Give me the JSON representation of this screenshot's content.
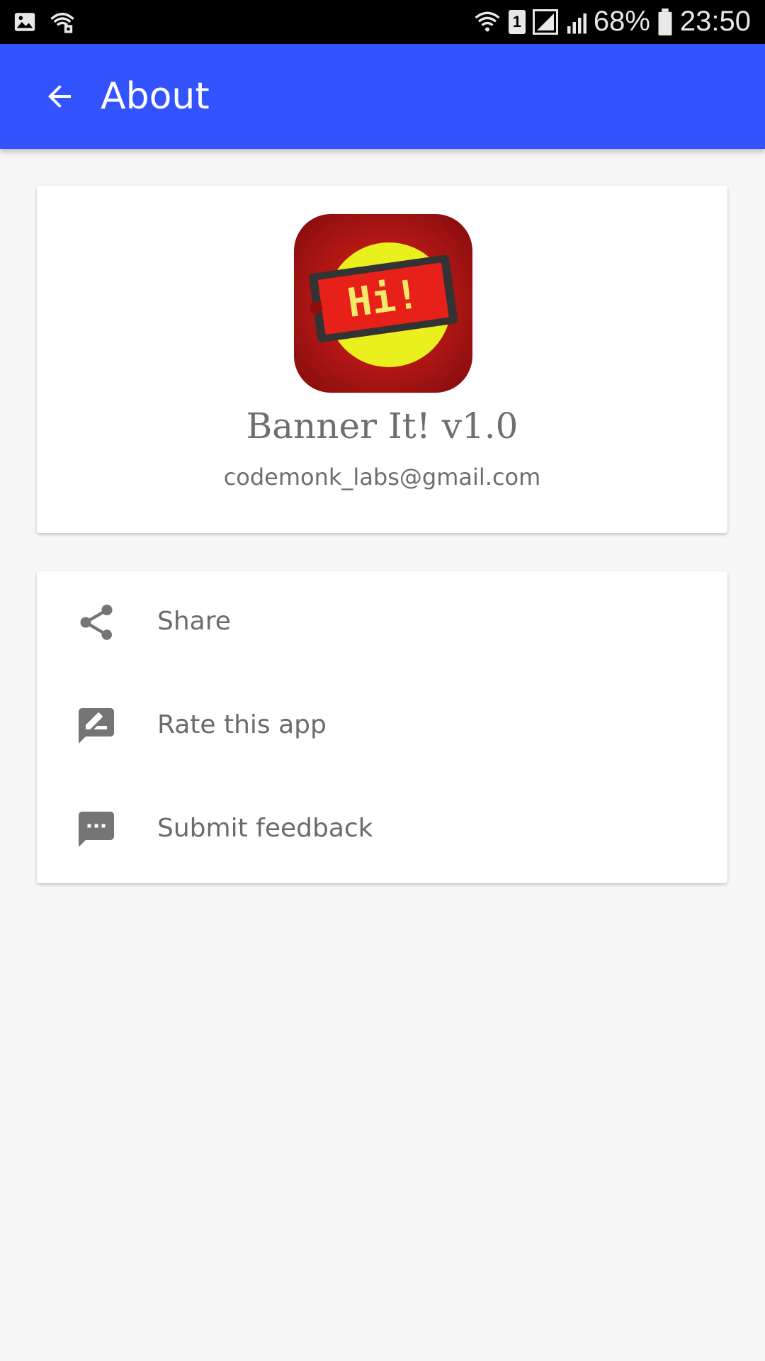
{
  "status_bar": {
    "sim_slot": "1",
    "battery": "68%",
    "time": "23:50"
  },
  "app_bar": {
    "title": "About"
  },
  "about": {
    "app_name": "Banner It! v1.0",
    "email": "codemonk_labs@gmail.com",
    "logo_text": "Hi!"
  },
  "actions": [
    {
      "label": "Share",
      "icon": "share-icon"
    },
    {
      "label": "Rate this app",
      "icon": "rate-review-icon"
    },
    {
      "label": "Submit feedback",
      "icon": "feedback-icon"
    }
  ],
  "colors": {
    "primary": "#3353ff",
    "background": "#f7f7f7",
    "text": "#6e6e6e",
    "icon": "#757575"
  }
}
